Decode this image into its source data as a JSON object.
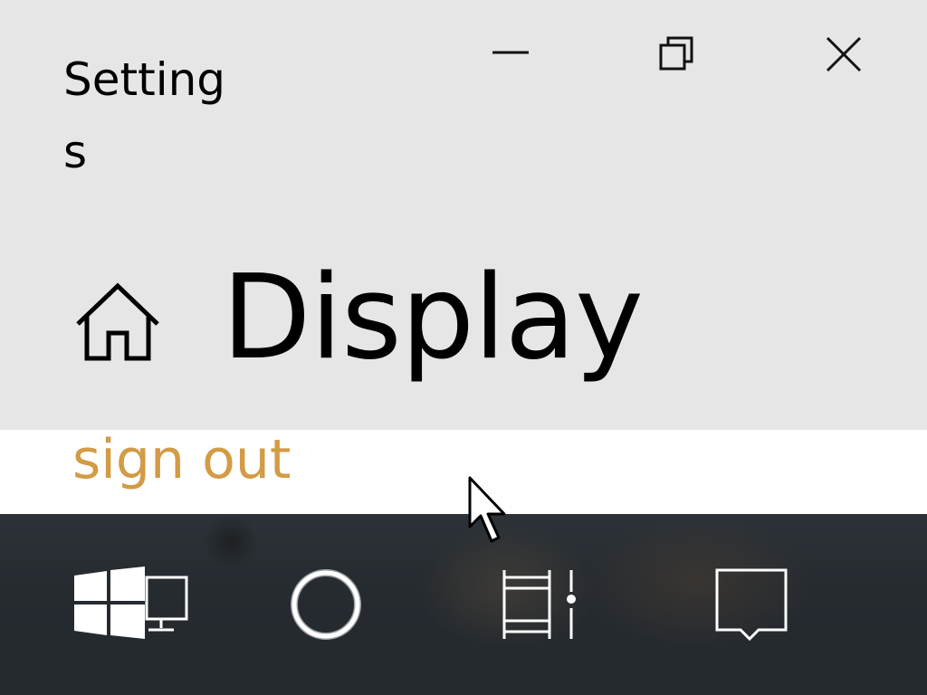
{
  "window": {
    "title": "Settings",
    "controls": {
      "minimize_icon": "minimize-icon",
      "restore_icon": "restore-icon",
      "close_icon": "close-icon"
    }
  },
  "page": {
    "home_icon": "home-icon",
    "title": "Display"
  },
  "content": {
    "sign_out_link": "sign out",
    "link_color": "#d39b45"
  },
  "taskbar": {
    "items": [
      {
        "icon": "start-continuum-icon"
      },
      {
        "icon": "cortana-icon"
      },
      {
        "icon": "task-view-icon"
      },
      {
        "icon": "action-center-icon"
      }
    ]
  },
  "colors": {
    "header_bg": "#e6e6e6",
    "content_bg": "#ffffff",
    "taskbar_bg": "#262b30"
  }
}
